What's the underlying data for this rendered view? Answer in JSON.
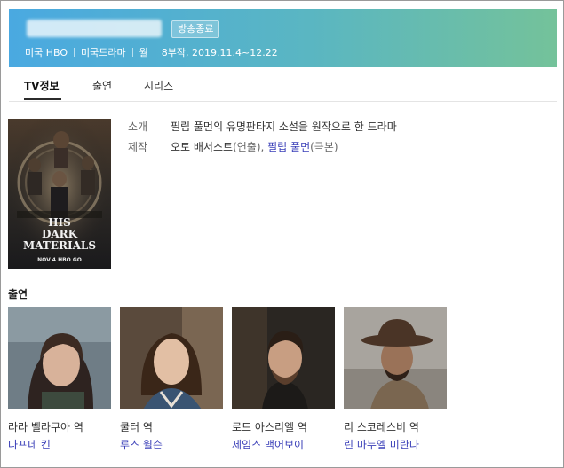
{
  "header": {
    "status_badge": "방송종료",
    "meta": [
      "미국 HBO",
      "미국드라마",
      "월",
      "8부작, 2019.11.4~12.22"
    ]
  },
  "tabs": [
    {
      "label": "TV정보",
      "active": true
    },
    {
      "label": "출연",
      "active": false
    },
    {
      "label": "시리즈",
      "active": false
    }
  ],
  "poster": {
    "title_line1": "HIS",
    "title_line2": "DARK",
    "title_line3": "MATERIALS",
    "date_text": "NOV 4 HBO GO"
  },
  "info": {
    "intro_label": "소개",
    "intro_text": "필립 풀먼의 유명판타지 소설을 원작으로 한 드라마",
    "credits_label": "제작",
    "director": "오토 배서스트",
    "director_role": "(연출), ",
    "writer": "필립 풀먼",
    "writer_role": "(극본)"
  },
  "cast": {
    "heading": "출연",
    "members": [
      {
        "role": "라라 벨라쿠아 역",
        "actor": "다프네 킨"
      },
      {
        "role": "쿨터 역",
        "actor": "루스 윌슨"
      },
      {
        "role": "로드 아스리엘 역",
        "actor": "제임스 맥어보이"
      },
      {
        "role": "리 스코레스비 역",
        "actor": "린 마누엘 미란다"
      }
    ]
  },
  "colors": {
    "header_start": "#4aa9e1",
    "header_end": "#74c29a",
    "link": "#3a3fb8"
  }
}
